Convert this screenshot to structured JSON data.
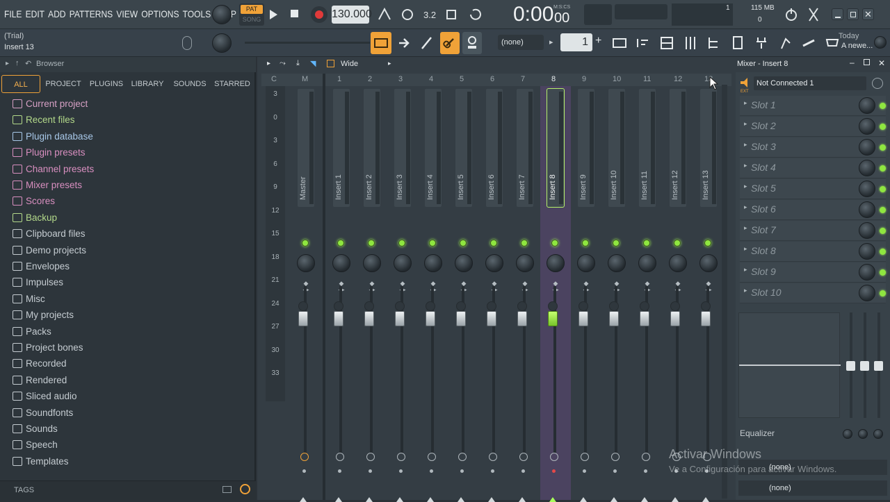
{
  "menu": [
    "FILE",
    "EDIT",
    "ADD",
    "PATTERNS",
    "VIEW",
    "OPTIONS",
    "TOOLS",
    "HELP"
  ],
  "transport": {
    "pat_label": "PAT",
    "song_label": "SONG",
    "tempo": "130.000",
    "time": "0:00",
    "time_sub": "00",
    "time_unit": "M:S:CS",
    "cpu_count": "1",
    "memory": "115 MB",
    "poly": "0"
  },
  "hint": {
    "line1": "(Trial)",
    "line2": "Insert 13"
  },
  "pattern_select": "(none)",
  "pattern_number": "1",
  "news": {
    "line1": "Today",
    "line2": "A newe..."
  },
  "browser": {
    "title": "Browser",
    "tabs": [
      "ALL",
      "PROJECT",
      "PLUGINS",
      "LIBRARY",
      "SOUNDS",
      "STARRED"
    ],
    "items": [
      {
        "label": "Current project",
        "color": "#d6a0c4",
        "icon": "project-icon"
      },
      {
        "label": "Recent files",
        "color": "#b3d98a",
        "icon": "recent-folder-icon"
      },
      {
        "label": "Plugin database",
        "color": "#a8c8e8",
        "icon": "plug-icon"
      },
      {
        "label": "Plugin presets",
        "color": "#d98fc0",
        "icon": "plug-icon"
      },
      {
        "label": "Channel presets",
        "color": "#d98fc0",
        "icon": "channel-icon"
      },
      {
        "label": "Mixer presets",
        "color": "#d98fc0",
        "icon": "mixer-icon"
      },
      {
        "label": "Scores",
        "color": "#d98fc0",
        "icon": "note-icon"
      },
      {
        "label": "Backup",
        "color": "#b3d98a",
        "icon": "backup-folder-icon"
      },
      {
        "label": "Clipboard files",
        "color": "#c5ccd1",
        "icon": "folder-icon"
      },
      {
        "label": "Demo projects",
        "color": "#c5ccd1",
        "icon": "folder-icon"
      },
      {
        "label": "Envelopes",
        "color": "#c5ccd1",
        "icon": "folder-icon"
      },
      {
        "label": "Impulses",
        "color": "#c5ccd1",
        "icon": "folder-icon"
      },
      {
        "label": "Misc",
        "color": "#c5ccd1",
        "icon": "folder-icon"
      },
      {
        "label": "My projects",
        "color": "#c5ccd1",
        "icon": "folder-icon"
      },
      {
        "label": "Packs",
        "color": "#c5ccd1",
        "icon": "packs-icon"
      },
      {
        "label": "Project bones",
        "color": "#c5ccd1",
        "icon": "folder-icon"
      },
      {
        "label": "Recorded",
        "color": "#c5ccd1",
        "icon": "record-icon"
      },
      {
        "label": "Rendered",
        "color": "#c5ccd1",
        "icon": "render-icon"
      },
      {
        "label": "Sliced audio",
        "color": "#c5ccd1",
        "icon": "slice-icon"
      },
      {
        "label": "Soundfonts",
        "color": "#c5ccd1",
        "icon": "folder-icon"
      },
      {
        "label": "Sounds",
        "color": "#c5ccd1",
        "icon": "cloud-icon"
      },
      {
        "label": "Speech",
        "color": "#c5ccd1",
        "icon": "folder-icon"
      },
      {
        "label": "Templates",
        "color": "#c5ccd1",
        "icon": "folder-icon"
      }
    ],
    "tags_label": "TAGS"
  },
  "mixer": {
    "view_mode": "Wide",
    "ruler": [
      "C",
      "M",
      "1",
      "2",
      "3",
      "4",
      "5",
      "6",
      "7",
      "8",
      "9",
      "10",
      "11",
      "12",
      "13"
    ],
    "db_scale": [
      "3",
      "0",
      "3",
      "6",
      "9",
      "12",
      "15",
      "18",
      "21",
      "24",
      "27",
      "30",
      "33"
    ],
    "channels": [
      "Master",
      "Insert 1",
      "Insert 2",
      "Insert 3",
      "Insert 4",
      "Insert 5",
      "Insert 6",
      "Insert 7",
      "Insert 8",
      "Insert 9",
      "Insert 10",
      "Insert 11",
      "Insert 12",
      "Insert 13"
    ],
    "selected_index": 8,
    "accent": "#a8ff5a"
  },
  "insert_panel": {
    "title": "Mixer - Insert 8",
    "input": "Not Connected 1",
    "slots": [
      "Slot 1",
      "Slot 2",
      "Slot 3",
      "Slot 4",
      "Slot 5",
      "Slot 6",
      "Slot 7",
      "Slot 8",
      "Slot 9",
      "Slot 10"
    ],
    "equalizer_label": "Equalizer",
    "out1": "(none)",
    "out2": "(none)"
  },
  "watermark": {
    "line1": "Activar Windows",
    "line2": "Ve a Configuración para activar Windows."
  }
}
